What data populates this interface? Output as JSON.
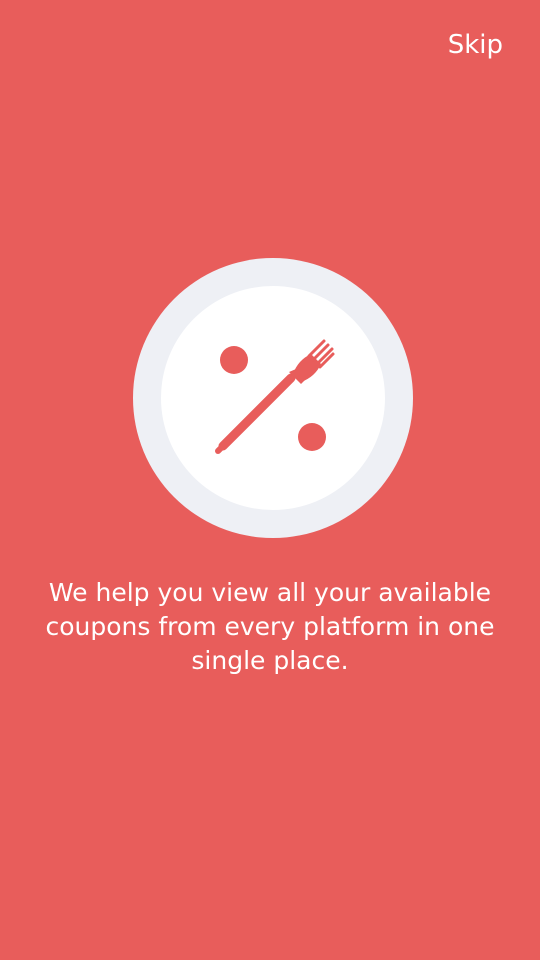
{
  "header": {
    "skip_label": "Skip"
  },
  "illustration": {
    "icon": "percent-fork-plate-icon",
    "colors": {
      "background": "#E85D5B",
      "plate_rim": "#EEF0F5",
      "plate_center": "#FFFFFF",
      "accent": "#E85D5B"
    }
  },
  "onboarding": {
    "description": "We help you view all your available coupons from every platform in one single place."
  }
}
